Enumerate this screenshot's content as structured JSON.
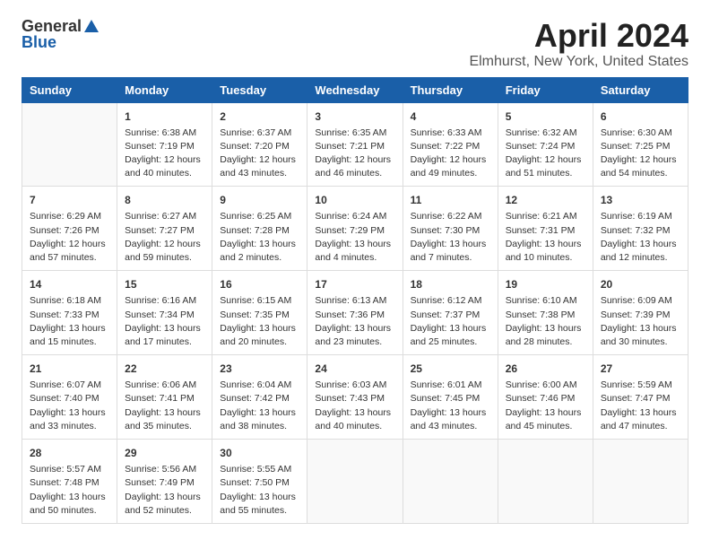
{
  "logo": {
    "general": "General",
    "blue": "Blue"
  },
  "title": "April 2024",
  "subtitle": "Elmhurst, New York, United States",
  "weekdays": [
    "Sunday",
    "Monday",
    "Tuesday",
    "Wednesday",
    "Thursday",
    "Friday",
    "Saturday"
  ],
  "weeks": [
    [
      {
        "day": "",
        "info": ""
      },
      {
        "day": "1",
        "info": "Sunrise: 6:38 AM\nSunset: 7:19 PM\nDaylight: 12 hours\nand 40 minutes."
      },
      {
        "day": "2",
        "info": "Sunrise: 6:37 AM\nSunset: 7:20 PM\nDaylight: 12 hours\nand 43 minutes."
      },
      {
        "day": "3",
        "info": "Sunrise: 6:35 AM\nSunset: 7:21 PM\nDaylight: 12 hours\nand 46 minutes."
      },
      {
        "day": "4",
        "info": "Sunrise: 6:33 AM\nSunset: 7:22 PM\nDaylight: 12 hours\nand 49 minutes."
      },
      {
        "day": "5",
        "info": "Sunrise: 6:32 AM\nSunset: 7:24 PM\nDaylight: 12 hours\nand 51 minutes."
      },
      {
        "day": "6",
        "info": "Sunrise: 6:30 AM\nSunset: 7:25 PM\nDaylight: 12 hours\nand 54 minutes."
      }
    ],
    [
      {
        "day": "7",
        "info": "Sunrise: 6:29 AM\nSunset: 7:26 PM\nDaylight: 12 hours\nand 57 minutes."
      },
      {
        "day": "8",
        "info": "Sunrise: 6:27 AM\nSunset: 7:27 PM\nDaylight: 12 hours\nand 59 minutes."
      },
      {
        "day": "9",
        "info": "Sunrise: 6:25 AM\nSunset: 7:28 PM\nDaylight: 13 hours\nand 2 minutes."
      },
      {
        "day": "10",
        "info": "Sunrise: 6:24 AM\nSunset: 7:29 PM\nDaylight: 13 hours\nand 4 minutes."
      },
      {
        "day": "11",
        "info": "Sunrise: 6:22 AM\nSunset: 7:30 PM\nDaylight: 13 hours\nand 7 minutes."
      },
      {
        "day": "12",
        "info": "Sunrise: 6:21 AM\nSunset: 7:31 PM\nDaylight: 13 hours\nand 10 minutes."
      },
      {
        "day": "13",
        "info": "Sunrise: 6:19 AM\nSunset: 7:32 PM\nDaylight: 13 hours\nand 12 minutes."
      }
    ],
    [
      {
        "day": "14",
        "info": "Sunrise: 6:18 AM\nSunset: 7:33 PM\nDaylight: 13 hours\nand 15 minutes."
      },
      {
        "day": "15",
        "info": "Sunrise: 6:16 AM\nSunset: 7:34 PM\nDaylight: 13 hours\nand 17 minutes."
      },
      {
        "day": "16",
        "info": "Sunrise: 6:15 AM\nSunset: 7:35 PM\nDaylight: 13 hours\nand 20 minutes."
      },
      {
        "day": "17",
        "info": "Sunrise: 6:13 AM\nSunset: 7:36 PM\nDaylight: 13 hours\nand 23 minutes."
      },
      {
        "day": "18",
        "info": "Sunrise: 6:12 AM\nSunset: 7:37 PM\nDaylight: 13 hours\nand 25 minutes."
      },
      {
        "day": "19",
        "info": "Sunrise: 6:10 AM\nSunset: 7:38 PM\nDaylight: 13 hours\nand 28 minutes."
      },
      {
        "day": "20",
        "info": "Sunrise: 6:09 AM\nSunset: 7:39 PM\nDaylight: 13 hours\nand 30 minutes."
      }
    ],
    [
      {
        "day": "21",
        "info": "Sunrise: 6:07 AM\nSunset: 7:40 PM\nDaylight: 13 hours\nand 33 minutes."
      },
      {
        "day": "22",
        "info": "Sunrise: 6:06 AM\nSunset: 7:41 PM\nDaylight: 13 hours\nand 35 minutes."
      },
      {
        "day": "23",
        "info": "Sunrise: 6:04 AM\nSunset: 7:42 PM\nDaylight: 13 hours\nand 38 minutes."
      },
      {
        "day": "24",
        "info": "Sunrise: 6:03 AM\nSunset: 7:43 PM\nDaylight: 13 hours\nand 40 minutes."
      },
      {
        "day": "25",
        "info": "Sunrise: 6:01 AM\nSunset: 7:45 PM\nDaylight: 13 hours\nand 43 minutes."
      },
      {
        "day": "26",
        "info": "Sunrise: 6:00 AM\nSunset: 7:46 PM\nDaylight: 13 hours\nand 45 minutes."
      },
      {
        "day": "27",
        "info": "Sunrise: 5:59 AM\nSunset: 7:47 PM\nDaylight: 13 hours\nand 47 minutes."
      }
    ],
    [
      {
        "day": "28",
        "info": "Sunrise: 5:57 AM\nSunset: 7:48 PM\nDaylight: 13 hours\nand 50 minutes."
      },
      {
        "day": "29",
        "info": "Sunrise: 5:56 AM\nSunset: 7:49 PM\nDaylight: 13 hours\nand 52 minutes."
      },
      {
        "day": "30",
        "info": "Sunrise: 5:55 AM\nSunset: 7:50 PM\nDaylight: 13 hours\nand 55 minutes."
      },
      {
        "day": "",
        "info": ""
      },
      {
        "day": "",
        "info": ""
      },
      {
        "day": "",
        "info": ""
      },
      {
        "day": "",
        "info": ""
      }
    ]
  ]
}
